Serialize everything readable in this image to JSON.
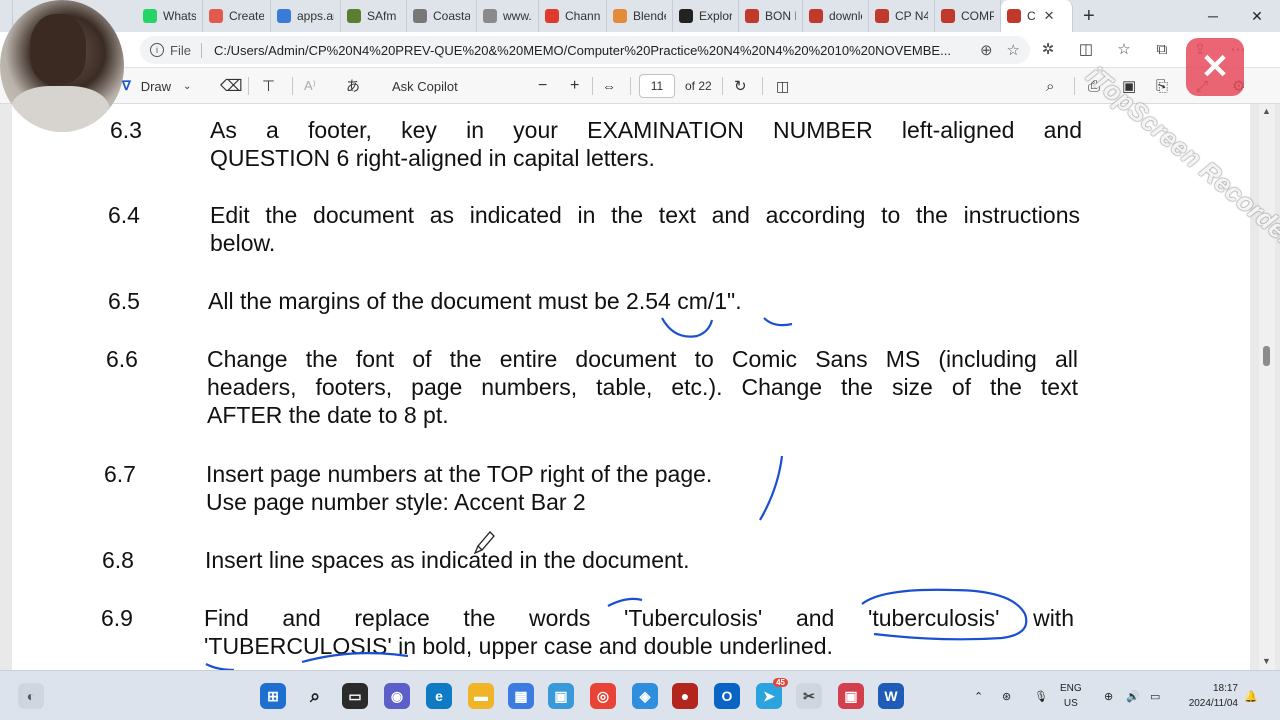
{
  "browser": {
    "tabs": [
      {
        "label": "WhatsA",
        "color": "#25d366"
      },
      {
        "label": "Create",
        "color": "#e25a4f"
      },
      {
        "label": "apps.ar",
        "color": "#3a7bd5"
      },
      {
        "label": "SAfm -",
        "color": "#5a7f2e"
      },
      {
        "label": "Coasta",
        "color": "#777777"
      },
      {
        "label": "www.d",
        "color": "#8a8a8a"
      },
      {
        "label": "Channe",
        "color": "#e03a2f"
      },
      {
        "label": "Blende",
        "color": "#e48a3b"
      },
      {
        "label": "Explore",
        "color": "#222222"
      },
      {
        "label": "BON IN",
        "color": "#c0392b"
      },
      {
        "label": "downlc",
        "color": "#c0392b"
      },
      {
        "label": "CP N4",
        "color": "#c0392b"
      },
      {
        "label": "COMPL",
        "color": "#c0392b"
      },
      {
        "label": "C",
        "color": "#c0392b"
      }
    ],
    "new_tab": "+",
    "window": {
      "minimize": "─",
      "maximize": "❐",
      "close": "✕"
    },
    "address": {
      "info": "i",
      "file_label": "File",
      "url": "C:/Users/Admin/CP%20N4%20PREV-QUE%20&%20MEMO/Computer%20Practice%20N4%20N4%20%2010%20NOVEMBE..."
    }
  },
  "pdf_toolbar": {
    "draw_label": "Draw",
    "copilot_label": "Ask Copilot",
    "zoom_out": "−",
    "zoom_in": "+",
    "page_current": "11",
    "page_total": "of 22"
  },
  "document": {
    "items": [
      {
        "num": "6.3",
        "lines": [
          "As a footer, key in your EXAMINATION NUMBER left-aligned and",
          "QUESTION 6 right-aligned in capital letters."
        ]
      },
      {
        "num": "6.4",
        "lines": [
          "Edit the document as indicated in the text and according to the instructions",
          "below."
        ]
      },
      {
        "num": "6.5",
        "lines": [
          "All the margins of the document must be 2.54 cm/1\"."
        ]
      },
      {
        "num": "6.6",
        "lines": [
          "Change the font of the entire document to Comic Sans MS (including all",
          "headers, footers, page numbers, table, etc.). Change the size of the text",
          "AFTER the date to 8 pt."
        ]
      },
      {
        "num": "6.7",
        "lines": [
          "Insert page numbers at the TOP right of the page.",
          "Use page number style: Accent Bar 2"
        ]
      },
      {
        "num": "6.8",
        "lines": [
          "Insert line spaces as indicated in the document."
        ]
      },
      {
        "num": "6.9",
        "lines": [
          "Find and replace the words 'Tuberculosis' and 'tuberculosis' with",
          "'TUBERCULOSIS' in bold, upper case and double underlined."
        ]
      }
    ]
  },
  "overlay": {
    "watermark": "iTopScreen Recorder"
  },
  "taskbar": {
    "badge_count": "45",
    "lang_top": "ENG",
    "lang_bottom": "US",
    "time": "18:17",
    "date": "2024/11/04"
  }
}
